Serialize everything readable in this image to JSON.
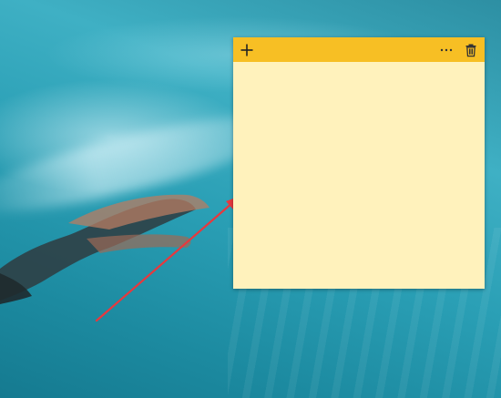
{
  "wallpaper": {
    "description_icon": "underwater-diver-wallpaper"
  },
  "sticky_note": {
    "header_color": "#f7bf24",
    "body_color": "#fff2bc",
    "add_icon": "plus-icon",
    "menu_icon": "ellipsis-icon",
    "delete_icon": "trash-icon",
    "body_text": ""
  },
  "annotation": {
    "arrow_color": "#e8383d",
    "arrow_icon": "red-arrow"
  }
}
